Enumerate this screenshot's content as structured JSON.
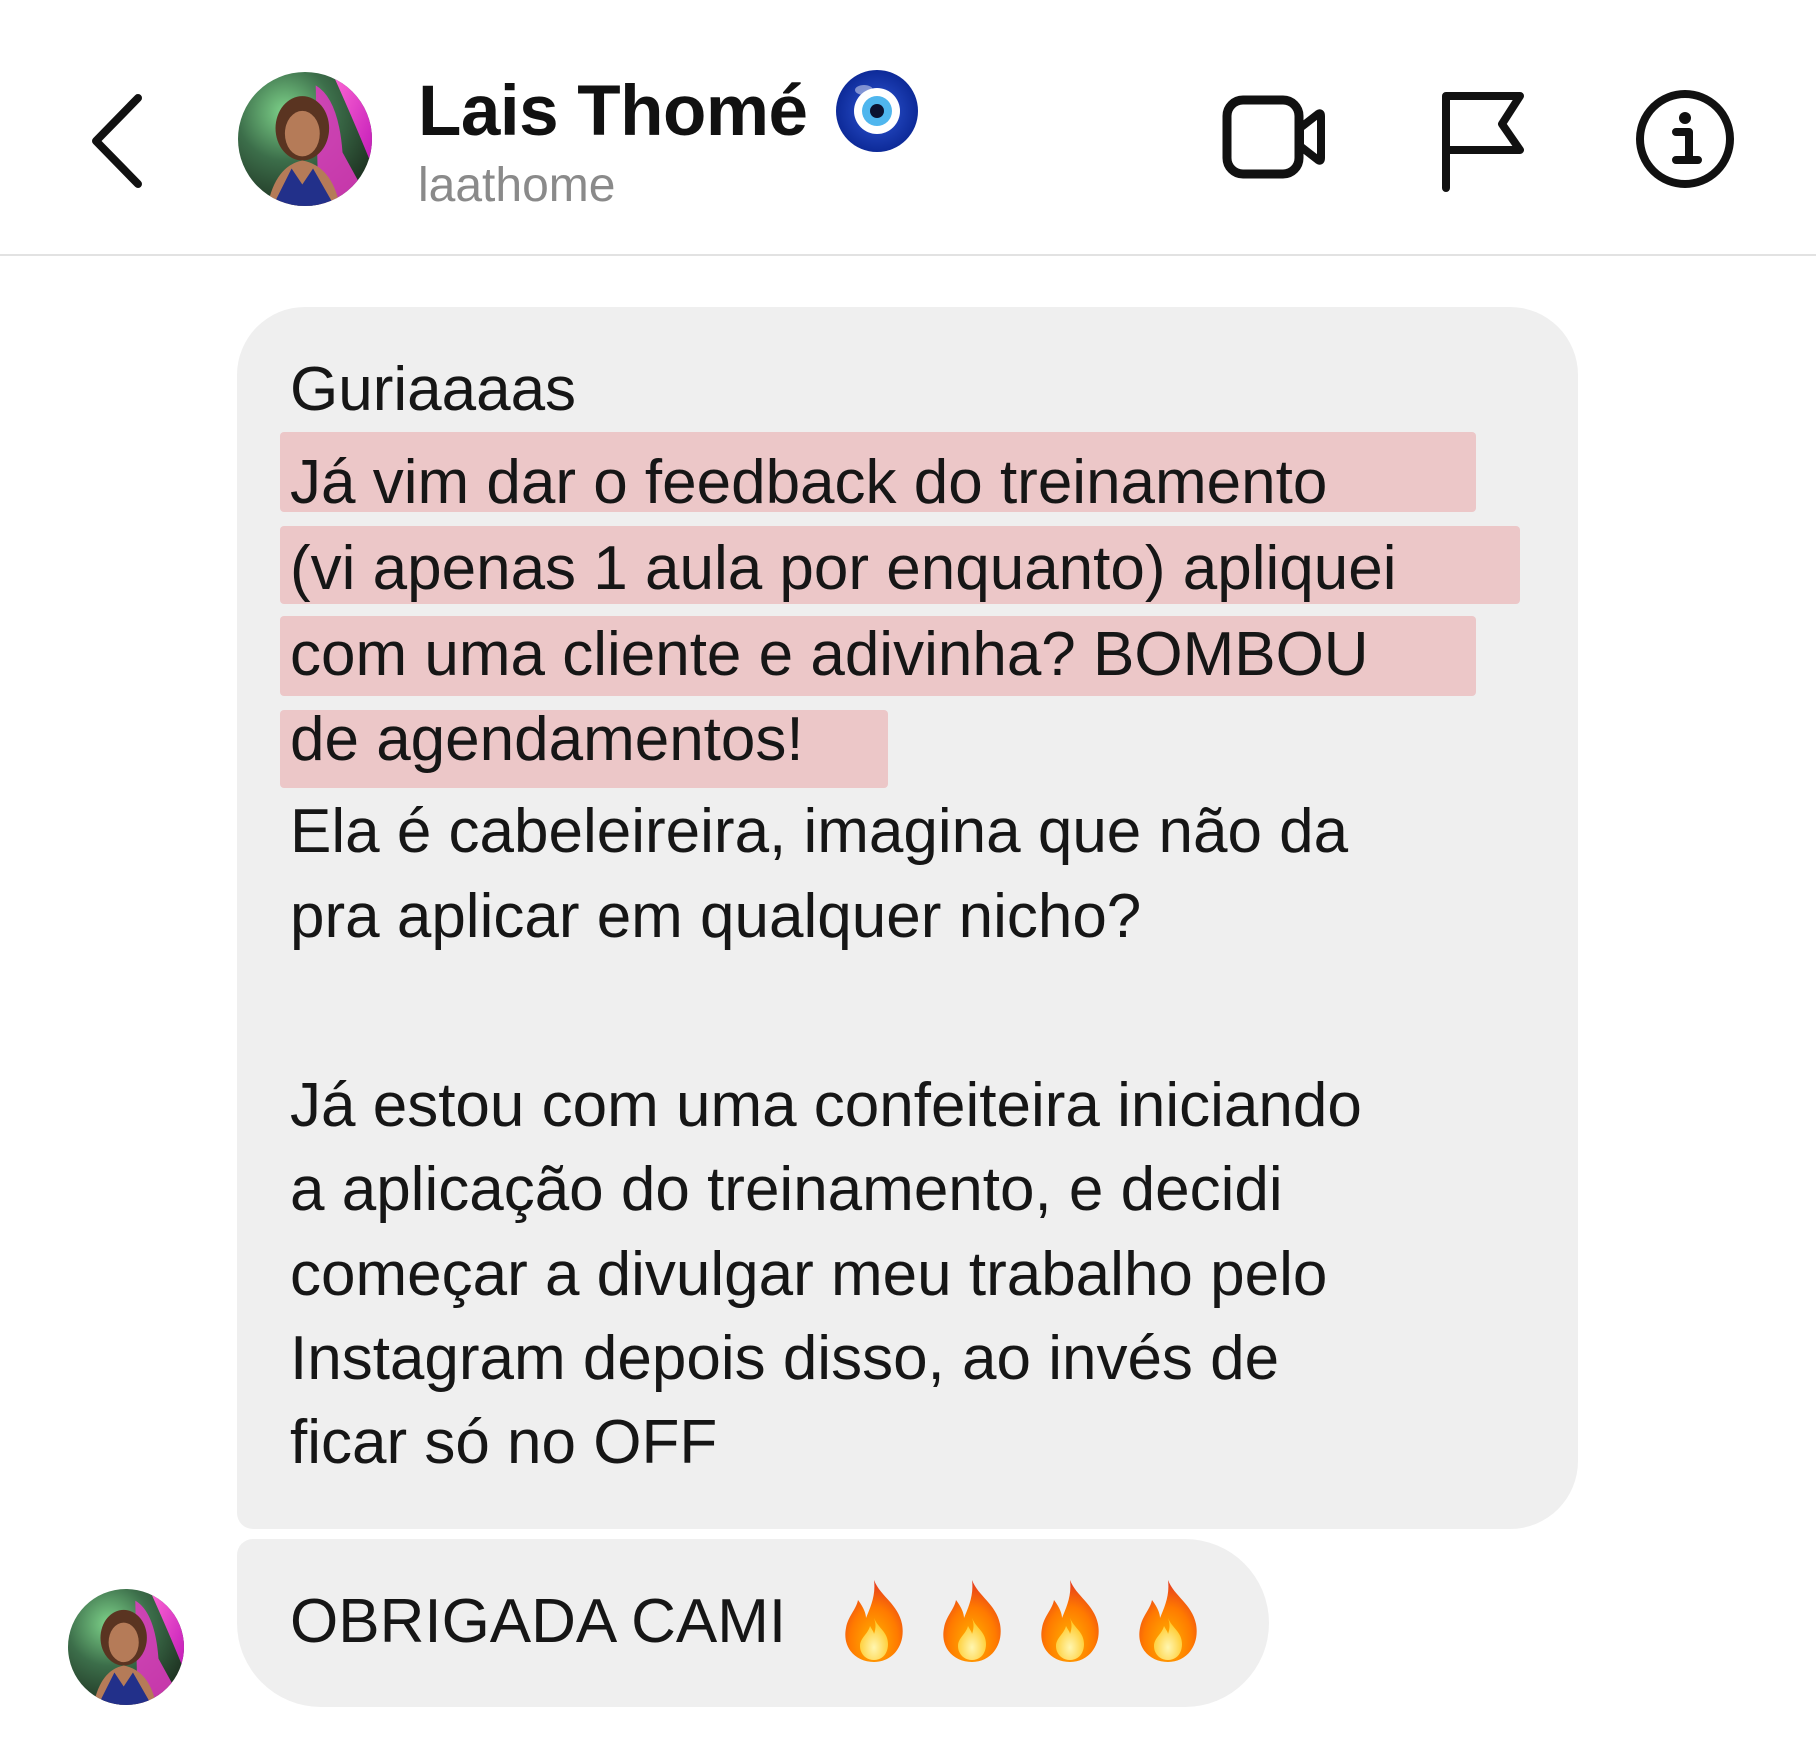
{
  "header": {
    "contact_name": "Lais Thomé",
    "username": "laathome",
    "back_icon": "chevron-left-icon",
    "verified_icon": "evil-eye-icon",
    "actions": [
      {
        "icon": "video-camera-icon"
      },
      {
        "icon": "flag-icon"
      },
      {
        "icon": "info-icon"
      }
    ]
  },
  "messages": [
    {
      "lines": [
        "Guriaaaas",
        "Já vim dar o feedback do treinamento",
        "(vi apenas 1 aula por enquanto) apliquei",
        "com uma cliente e adivinha? BOMBOU",
        "de agendamentos!",
        "Ela é cabeleireira, imagina que não da",
        "pra aplicar em qualquer nicho?",
        "",
        "Já estou com uma confeiteira iniciando",
        "a aplicação do treinamento, e decidi",
        "começar a divulgar meu trabalho pelo",
        "Instagram depois disso, ao invés de",
        "ficar só no OFF"
      ],
      "highlight_color": "#ecc7c8"
    },
    {
      "text": "OBRIGADA CAMI",
      "emoji": [
        "🔥",
        "🔥",
        "🔥",
        "🔥"
      ]
    }
  ],
  "colors": {
    "bubble": "#efefef",
    "highlight": "#ecc7c8",
    "username": "#8a8a8a",
    "divider": "#e2e2e2"
  }
}
